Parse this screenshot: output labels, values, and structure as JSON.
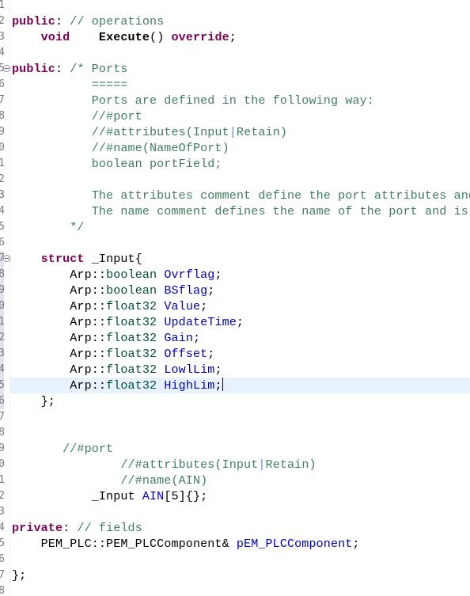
{
  "editor": {
    "language": "C++",
    "current_line_index": 24,
    "line_number_digits": [
      "1",
      "2",
      "3",
      "4",
      "5",
      "6",
      "7",
      "8",
      "9",
      "0",
      "1",
      "2",
      "3",
      "4",
      "5",
      "6",
      "7",
      "8",
      "9",
      "0",
      "1",
      "2",
      "3",
      "4",
      "5",
      "6",
      "7",
      "8",
      "9",
      "0",
      "1",
      "2",
      "3",
      "4",
      "5",
      "6",
      "7",
      "8"
    ],
    "lines": [
      {
        "tokens": []
      },
      {
        "tokens": [
          {
            "t": "kw",
            "v": "public"
          },
          {
            "t": "pl",
            "v": ": "
          },
          {
            "t": "cm",
            "v": "// operations"
          }
        ]
      },
      {
        "tokens": [
          {
            "t": "pl",
            "v": "    "
          },
          {
            "t": "kw",
            "v": "void"
          },
          {
            "t": "pl",
            "v": "    "
          },
          {
            "t": "fn",
            "v": "Execute"
          },
          {
            "t": "pl",
            "v": "() "
          },
          {
            "t": "kw",
            "v": "override"
          },
          {
            "t": "pl",
            "v": ";"
          }
        ]
      },
      {
        "tokens": []
      },
      {
        "fold": true,
        "tokens": [
          {
            "t": "kw",
            "v": "public"
          },
          {
            "t": "pl",
            "v": ": "
          },
          {
            "t": "cm",
            "v": "/* Ports"
          }
        ]
      },
      {
        "tokens": [
          {
            "t": "cm",
            "v": "           ====="
          }
        ]
      },
      {
        "tokens": [
          {
            "t": "cm",
            "v": "           Ports are defined in the following way:"
          }
        ]
      },
      {
        "tokens": [
          {
            "t": "cm",
            "v": "           //#port"
          }
        ]
      },
      {
        "tokens": [
          {
            "t": "cm",
            "v": "           //#attributes(Input"
          },
          {
            "t": "sep",
            "v": "|"
          },
          {
            "t": "cm",
            "v": "Retain)"
          }
        ]
      },
      {
        "tokens": [
          {
            "t": "cm",
            "v": "           //#name(NameOfPort)"
          }
        ]
      },
      {
        "tokens": [
          {
            "t": "cm",
            "v": "           boolean portField;"
          }
        ]
      },
      {
        "tokens": []
      },
      {
        "tokens": [
          {
            "t": "cm",
            "v": "           The attributes comment define the port attributes and"
          }
        ]
      },
      {
        "tokens": [
          {
            "t": "cm",
            "v": "           The name comment defines the name of the port and is c"
          }
        ]
      },
      {
        "tokens": [
          {
            "t": "cm",
            "v": "        */"
          }
        ]
      },
      {
        "tokens": []
      },
      {
        "fold": true,
        "tokens": [
          {
            "t": "pl",
            "v": "    "
          },
          {
            "t": "kw",
            "v": "struct"
          },
          {
            "t": "pl",
            "v": " _Input{"
          }
        ]
      },
      {
        "tokens": [
          {
            "t": "pl",
            "v": "        Arp::"
          },
          {
            "t": "tp",
            "v": "boolean"
          },
          {
            "t": "pl",
            "v": " "
          },
          {
            "t": "fld",
            "v": "Ovrflag"
          },
          {
            "t": "pl",
            "v": ";"
          }
        ]
      },
      {
        "tokens": [
          {
            "t": "pl",
            "v": "        Arp::"
          },
          {
            "t": "tp",
            "v": "boolean"
          },
          {
            "t": "pl",
            "v": " "
          },
          {
            "t": "fld",
            "v": "BSflag"
          },
          {
            "t": "pl",
            "v": ";"
          }
        ]
      },
      {
        "tokens": [
          {
            "t": "pl",
            "v": "        Arp::"
          },
          {
            "t": "tp",
            "v": "float32"
          },
          {
            "t": "pl",
            "v": " "
          },
          {
            "t": "fld",
            "v": "Value"
          },
          {
            "t": "pl",
            "v": ";"
          }
        ]
      },
      {
        "tokens": [
          {
            "t": "pl",
            "v": "        Arp::"
          },
          {
            "t": "tp",
            "v": "float32"
          },
          {
            "t": "pl",
            "v": " "
          },
          {
            "t": "fld",
            "v": "UpdateTime"
          },
          {
            "t": "pl",
            "v": ";"
          }
        ]
      },
      {
        "tokens": [
          {
            "t": "pl",
            "v": "        Arp::"
          },
          {
            "t": "tp",
            "v": "float32"
          },
          {
            "t": "pl",
            "v": " "
          },
          {
            "t": "fld",
            "v": "Gain"
          },
          {
            "t": "pl",
            "v": ";"
          }
        ]
      },
      {
        "tokens": [
          {
            "t": "pl",
            "v": "        Arp::"
          },
          {
            "t": "tp",
            "v": "float32"
          },
          {
            "t": "pl",
            "v": " "
          },
          {
            "t": "fld",
            "v": "Offset"
          },
          {
            "t": "pl",
            "v": ";"
          }
        ]
      },
      {
        "tokens": [
          {
            "t": "pl",
            "v": "        Arp::"
          },
          {
            "t": "tp",
            "v": "float32"
          },
          {
            "t": "pl",
            "v": " "
          },
          {
            "t": "fld",
            "v": "LowlLim"
          },
          {
            "t": "pl",
            "v": ";"
          }
        ]
      },
      {
        "tokens": [
          {
            "t": "pl",
            "v": "        Arp::"
          },
          {
            "t": "tp",
            "v": "float32"
          },
          {
            "t": "pl",
            "v": " "
          },
          {
            "t": "fld",
            "v": "HighLim"
          },
          {
            "t": "pl",
            "v": ";"
          }
        ],
        "cursor": true
      },
      {
        "tokens": [
          {
            "t": "pl",
            "v": "    };"
          }
        ]
      },
      {
        "tokens": []
      },
      {
        "tokens": []
      },
      {
        "tokens": [
          {
            "t": "cm",
            "v": "       //#port"
          }
        ]
      },
      {
        "tokens": [
          {
            "t": "cm",
            "v": "               //#attributes(Input"
          },
          {
            "t": "sep",
            "v": "|"
          },
          {
            "t": "cm",
            "v": "Retain)"
          }
        ]
      },
      {
        "tokens": [
          {
            "t": "cm",
            "v": "               //#name(AIN)"
          }
        ]
      },
      {
        "tokens": [
          {
            "t": "pl",
            "v": "           _Input "
          },
          {
            "t": "fld",
            "v": "AIN"
          },
          {
            "t": "pl",
            "v": "[5]{};"
          }
        ]
      },
      {
        "tokens": []
      },
      {
        "tokens": [
          {
            "t": "kw",
            "v": "private"
          },
          {
            "t": "pl",
            "v": ": "
          },
          {
            "t": "cm",
            "v": "// fields"
          }
        ]
      },
      {
        "tokens": [
          {
            "t": "pl",
            "v": "    PEM_PLC::PEM_PLCComponent& "
          },
          {
            "t": "fld",
            "v": "pEM_PLCComponent"
          },
          {
            "t": "pl",
            "v": ";"
          }
        ]
      },
      {
        "tokens": []
      },
      {
        "tokens": [
          {
            "t": "pl",
            "v": "};"
          }
        ]
      },
      {
        "tokens": []
      }
    ]
  },
  "colors": {
    "keyword": "#7f0055",
    "comment": "#3f7f5f",
    "typedef": "#005032",
    "field": "#0000c0",
    "plain": "#000000",
    "current_line": "#e8f2fe",
    "line_number": "#787878"
  }
}
